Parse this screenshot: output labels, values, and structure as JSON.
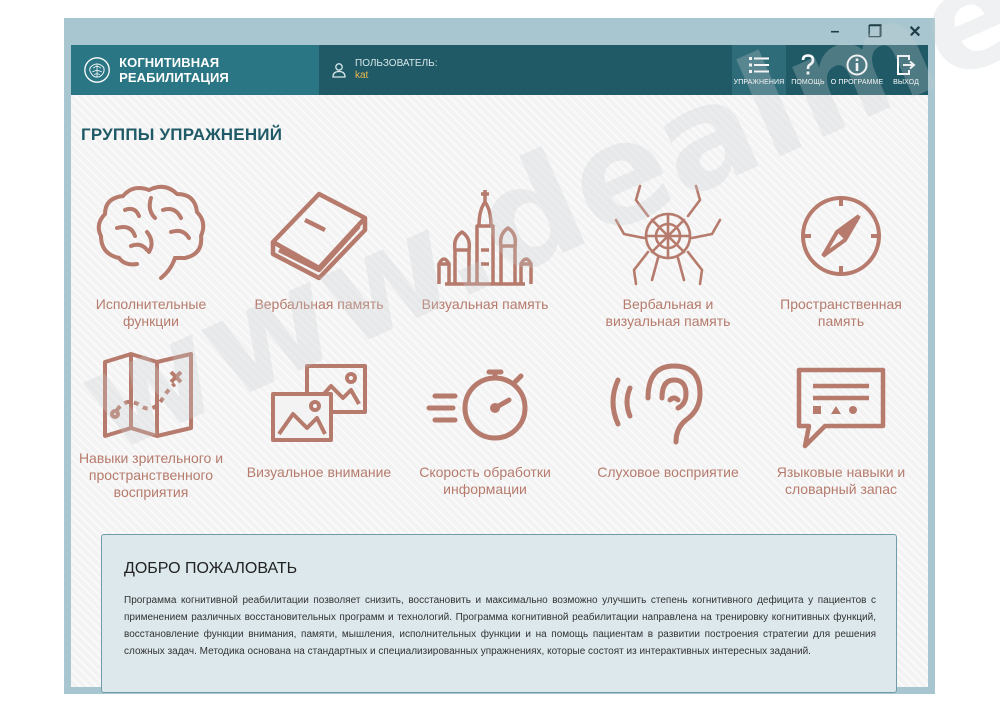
{
  "window": {
    "minimize": "–",
    "restore": "❐",
    "close": "✕"
  },
  "header": {
    "app_title": "КОГНИТИВНАЯ РЕАБИЛИТАЦИЯ",
    "user_label": "ПОЛЬЗОВАТЕЛЬ:",
    "user_name": "kat",
    "toolbar": [
      {
        "icon": "list-icon",
        "label": "УПРАЖНЕНИЯ",
        "active": true
      },
      {
        "icon": "question-icon",
        "label": "ПОМОЩЬ"
      },
      {
        "icon": "info-icon",
        "label": "О ПРОГРАММЕ"
      },
      {
        "icon": "exit-icon",
        "label": "ВЫХОД"
      }
    ]
  },
  "main": {
    "title": "ГРУППЫ УПРАЖНЕНИЙ",
    "groups": [
      {
        "icon": "brain-icon",
        "label": "Исполнительные функции"
      },
      {
        "icon": "book-icon",
        "label": "Вербальная память"
      },
      {
        "icon": "kremlin-icon",
        "label": "Визуальная память"
      },
      {
        "icon": "spider-icon",
        "label": "Вербальная и визуальная память"
      },
      {
        "icon": "compass-icon",
        "label": "Пространственная память"
      },
      {
        "icon": "map-icon",
        "label": "Навыки зрительного и пространственного восприятия"
      },
      {
        "icon": "pictures-icon",
        "label": "Визуальное внимание"
      },
      {
        "icon": "stopwatch-icon",
        "label": "Скорость обработки информации"
      },
      {
        "icon": "ear-icon",
        "label": "Слуховое восприятие"
      },
      {
        "icon": "speech-bubble-icon",
        "label": "Языковые навыки и словарный запас"
      }
    ]
  },
  "welcome": {
    "title": "ДОБРО ПОЖАЛОВАТЬ",
    "text": "Программа когнитивной реабилитации позволяет снизить, восстановить и максимально возможно улучшить степень когнитивного дефицита у пациентов с применением различных восстановительных программ и технологий. Программа когнитивной реабилитации направлена на тренировку когнитивных функций, восстановление функции внимания, памяти, мышления, исполнительных функции и на помощь пациентам в развитии построения стратегии для решения сложных задач. Методика основана на стандартных и специализированных упражнениях, которые состоят из интерактивных интересных заданий."
  },
  "watermark": "www.dealmed.ru",
  "colors": {
    "header": "#1f5a66",
    "brand": "#2b7684",
    "accent": "#b67b6c",
    "title": "#1f5a66",
    "username": "#f0b94c"
  }
}
